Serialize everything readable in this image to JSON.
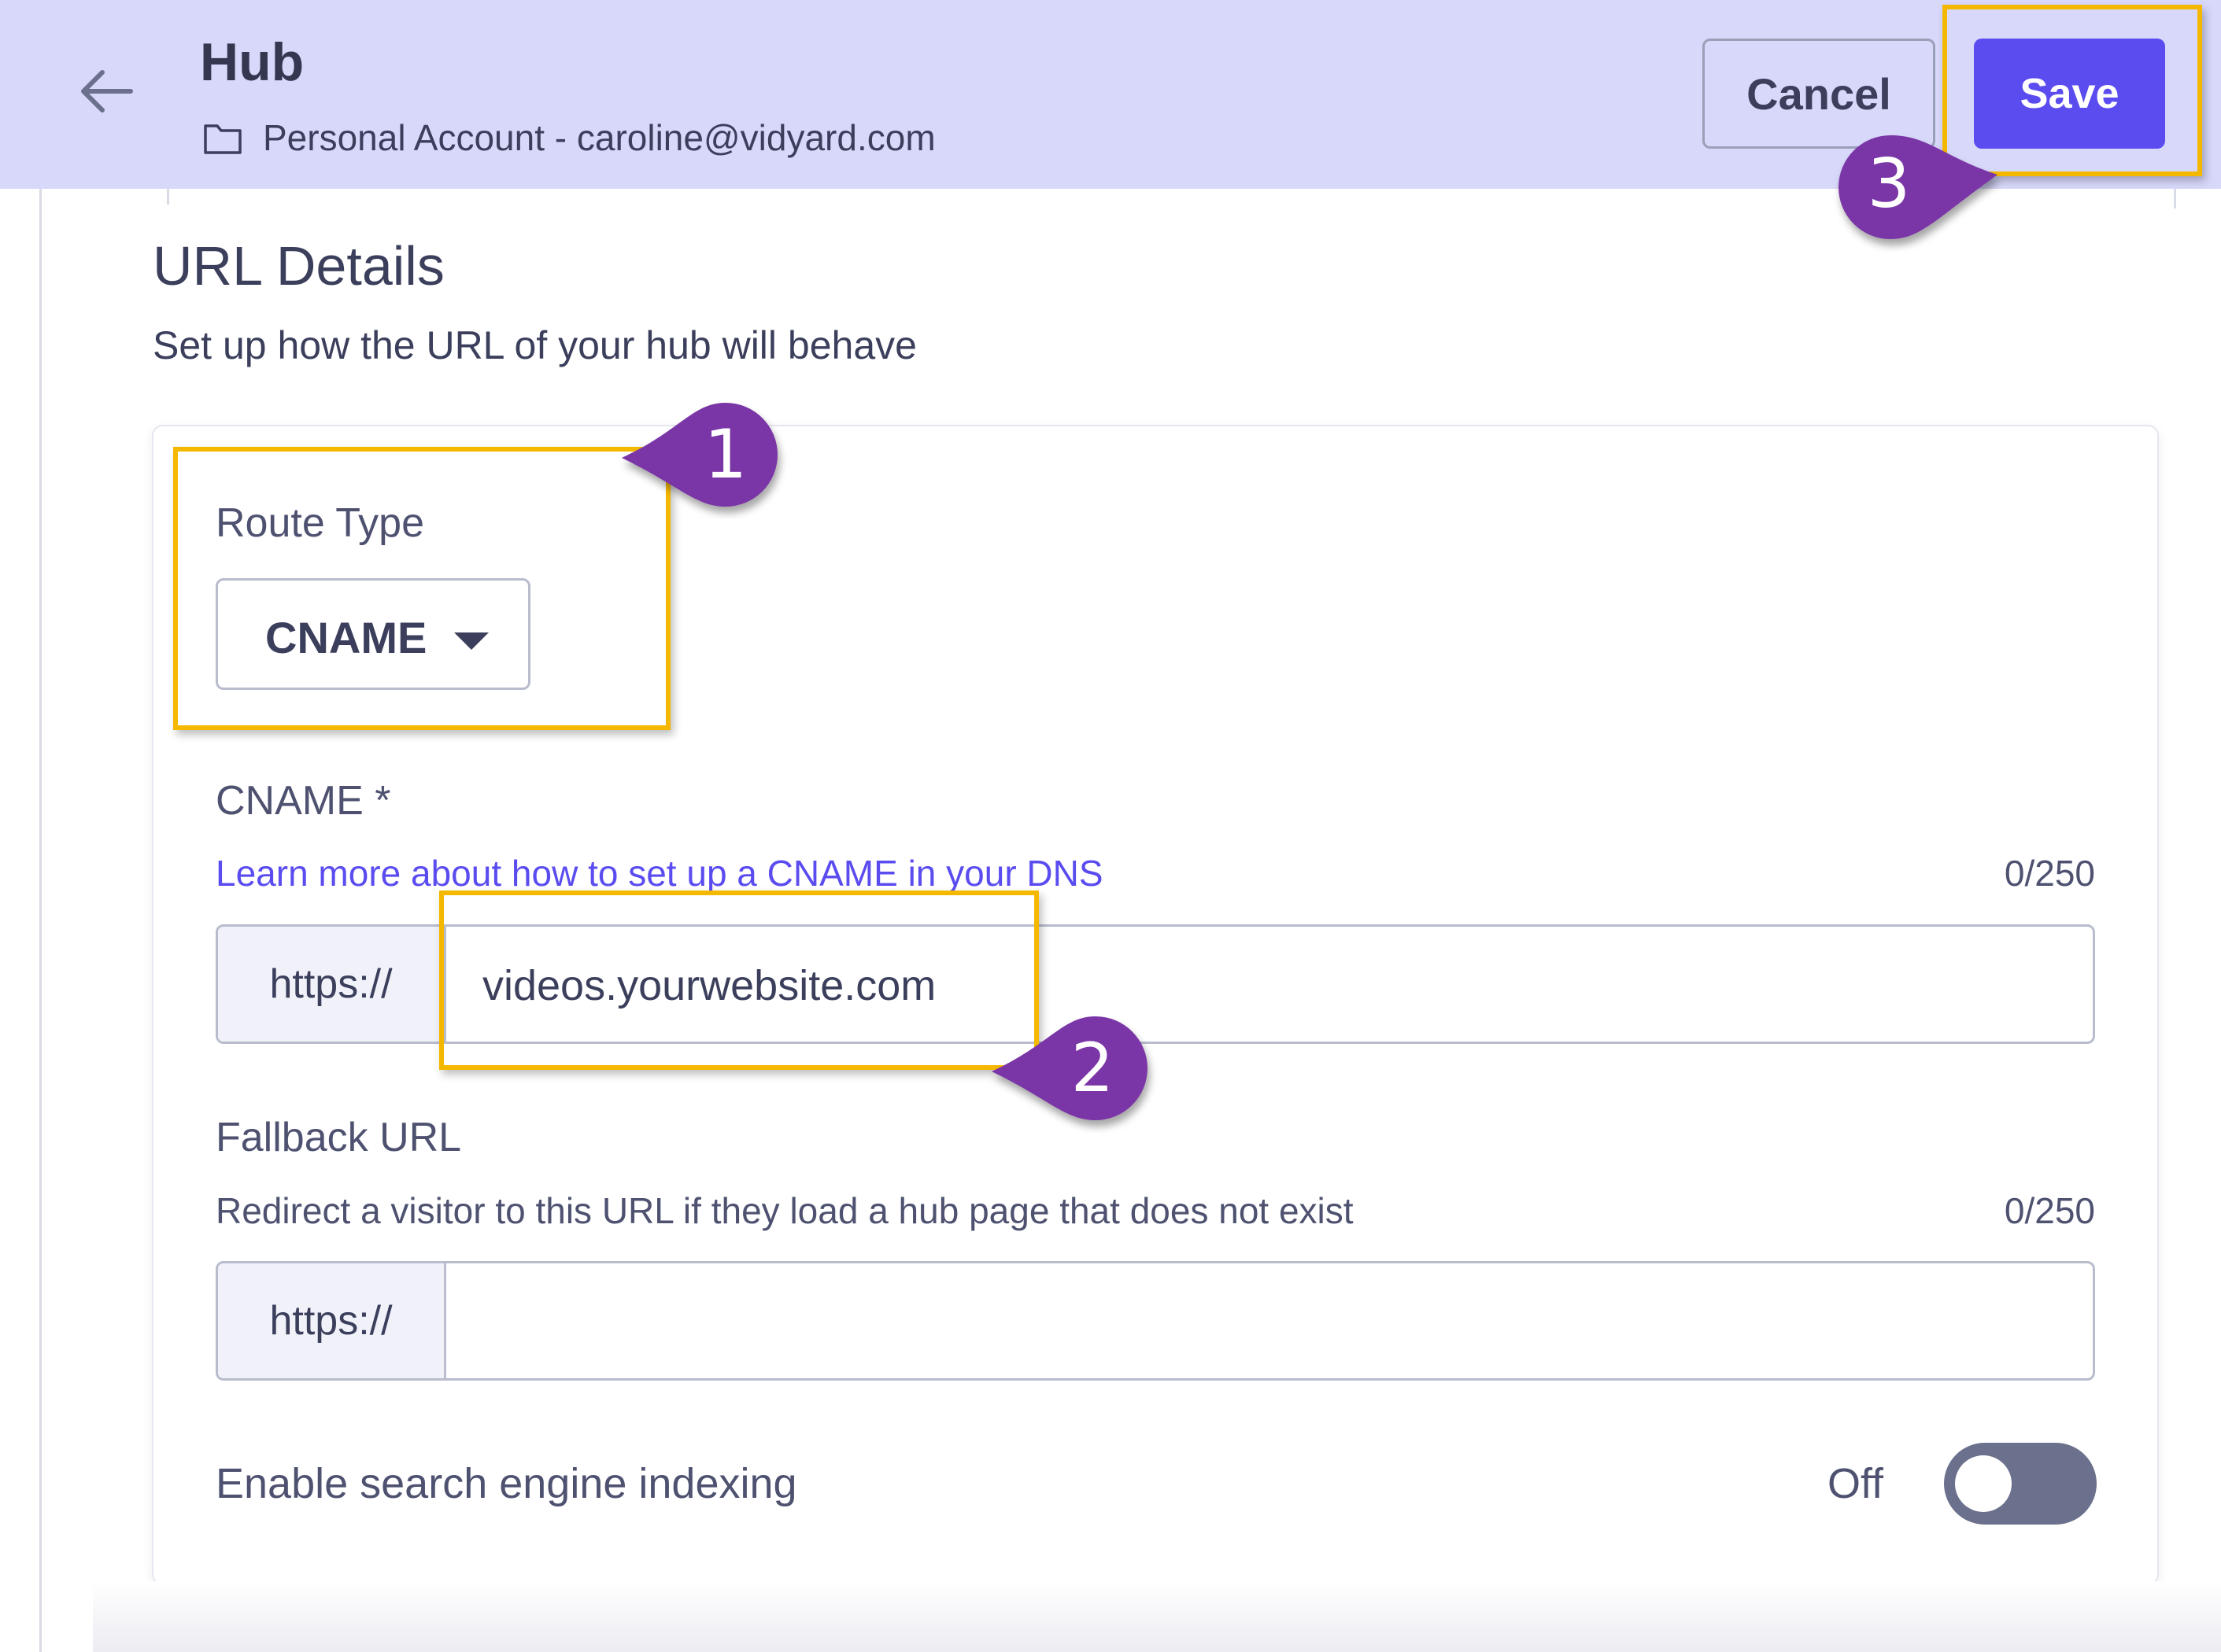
{
  "header": {
    "title": "Hub",
    "account": "Personal Account - caroline@vidyard.com",
    "cancel_label": "Cancel",
    "save_label": "Save"
  },
  "section": {
    "title": "URL Details",
    "subtitle": "Set up how the URL of your hub will behave"
  },
  "route_type": {
    "label": "Route Type",
    "selected": "CNAME"
  },
  "cname": {
    "label": "CNAME *",
    "help_link": "Learn more about how to set up a CNAME in your DNS",
    "counter": "0/250",
    "prefix": "https://",
    "value": "videos.yourwebsite.com"
  },
  "fallback": {
    "label": "Fallback URL",
    "description": "Redirect a visitor to this URL if they load a hub page that does not exist",
    "counter": "0/250",
    "prefix": "https://",
    "value": ""
  },
  "indexing": {
    "label": "Enable search engine indexing",
    "state": "Off"
  },
  "callouts": {
    "one": "1",
    "two": "2",
    "three": "3"
  },
  "colors": {
    "header_bg": "#d8d8fb",
    "accent": "#5b4cf0",
    "highlight": "#f5b800",
    "callout": "#7a35a6"
  },
  "icons": {
    "back": "back-arrow-icon",
    "folder": "folder-icon",
    "dropdown": "caret-down-icon"
  }
}
